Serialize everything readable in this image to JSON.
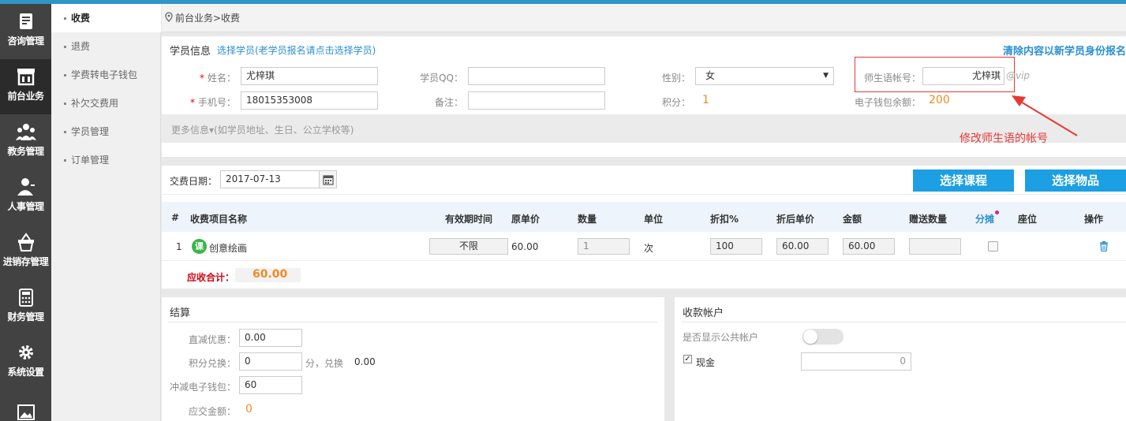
{
  "nav": {
    "items": [
      {
        "label": "咨询管理",
        "icon": "consult-icon"
      },
      {
        "label": "前台业务",
        "icon": "storefront-icon"
      },
      {
        "label": "教务管理",
        "icon": "group-icon"
      },
      {
        "label": "人事管理",
        "icon": "person-icon"
      },
      {
        "label": "进销存管理",
        "icon": "basket-icon"
      },
      {
        "label": "财务管理",
        "icon": "calculator-icon"
      },
      {
        "label": "系统设置",
        "icon": "gear-icon"
      },
      {
        "label": "",
        "icon": "image-icon"
      }
    ]
  },
  "submenu": {
    "items": [
      "收费",
      "退费",
      "学费转电子钱包",
      "补欠交费用",
      "学员管理",
      "订单管理"
    ]
  },
  "breadcrumb": "前台业务>收费",
  "student": {
    "section_title": "学员信息",
    "select_link": "选择学员(老学员报名请点击选择学员)",
    "clear_link": "清除内容以新学员身份报名",
    "name_label": "姓名：",
    "name_value": "尤梓琪",
    "qq_label": "学员QQ：",
    "qq_value": "",
    "gender_label": "性别：",
    "gender_value": "女",
    "account_label": "师生语帐号：",
    "account_value": "尤梓琪",
    "account_suffix": "@vip",
    "phone_label": "手机号：",
    "phone_value": "18015353008",
    "remark_label": "备注：",
    "remark_value": "",
    "points_label": "积分：",
    "points_value": "1",
    "wallet_label": "电子钱包余额：",
    "wallet_value": "200",
    "more_info": "更多信息▾(如学员地址、生日、公立学校等)",
    "annotation": "修改师生语的帐号"
  },
  "fee": {
    "date_label": "交费日期：",
    "date_value": "2017-07-13",
    "select_course_btn": "选择课程",
    "select_item_btn": "选择物品",
    "headers": [
      "#",
      "收费项目名称",
      "有效期时间",
      "原单价",
      "数量",
      "单位",
      "折扣%",
      "折后单价",
      "金额",
      "赠送数量",
      "分摊",
      "座位",
      "操作"
    ],
    "row": {
      "index": "1",
      "badge": "课",
      "name": "创意绘画",
      "validity": "不限",
      "price": "60.00",
      "qty": "1",
      "unit": "次",
      "discount": "100",
      "discount_price": "60.00",
      "amount": "60.00",
      "gift": ""
    },
    "total_label": "应收合计：",
    "total_value": "60.00"
  },
  "settle": {
    "title": "结算",
    "direct_label": "直减优惠：",
    "direct_value": "0.00",
    "points_label": "积分兑换：",
    "points_value": "0",
    "points_unit": "分，兑换",
    "points_exchange": "0.00",
    "wallet_label": "冲减电子钱包：",
    "wallet_value": "60",
    "due_label": "应交金额：",
    "due_value": "0"
  },
  "account": {
    "title": "收款帐户",
    "show_public_label": "是否显示公共帐户",
    "cash_label": "现金",
    "cash_value": "0"
  },
  "colors": {
    "accent": "#1c9fe3",
    "nav_bg": "#424242",
    "orange": "#f08a24",
    "annotation_red": "#e53935"
  }
}
